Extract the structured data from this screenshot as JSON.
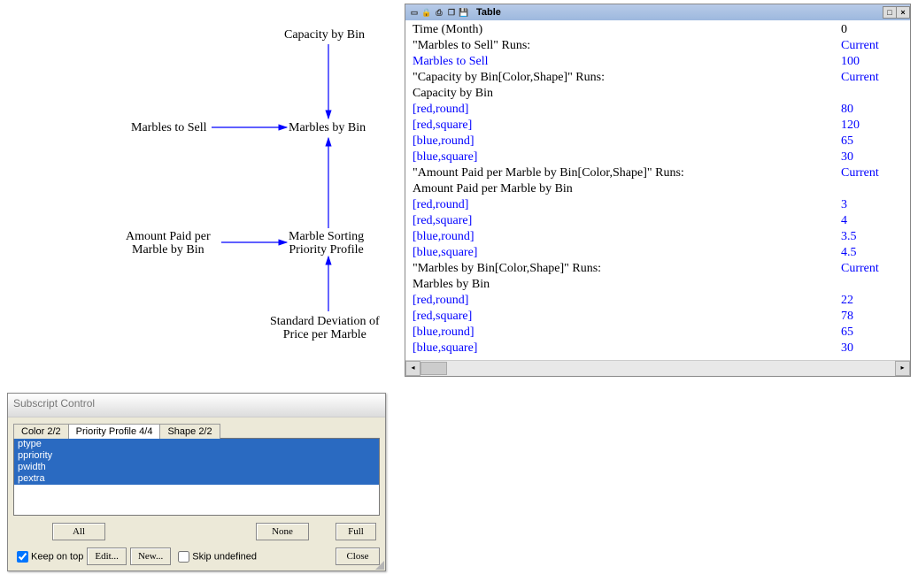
{
  "diagram": {
    "capacity_by_bin": "Capacity by Bin",
    "marbles_to_sell": "Marbles to Sell",
    "marbles_by_bin": "Marbles by Bin",
    "amount_paid_line1": "Amount Paid per",
    "amount_paid_line2": "Marble by Bin",
    "sorting_line1": "Marble Sorting",
    "sorting_line2": "Priority Profile",
    "stddev_line1": "Standard Deviation of",
    "stddev_line2": "Price per Marble"
  },
  "table_panel": {
    "title": "Table",
    "rows": [
      {
        "label": "Time (Month)",
        "value": "0",
        "lblue": false,
        "vblue": false
      },
      {
        "label": "\"Marbles to Sell\"  Runs:",
        "value": "Current",
        "lblue": false,
        "vblue": true
      },
      {
        "label": "Marbles to Sell",
        "value": "100",
        "lblue": true,
        "vblue": true
      },
      {
        "label": "\"Capacity by Bin[Color,Shape]\"  Runs:",
        "value": "Current",
        "lblue": false,
        "vblue": true
      },
      {
        "label": "Capacity by Bin",
        "value": "",
        "lblue": false,
        "vblue": false
      },
      {
        "label": "[red,round]",
        "value": "80",
        "lblue": true,
        "vblue": true
      },
      {
        "label": "[red,square]",
        "value": "120",
        "lblue": true,
        "vblue": true
      },
      {
        "label": "[blue,round]",
        "value": "65",
        "lblue": true,
        "vblue": true
      },
      {
        "label": "[blue,square]",
        "value": "30",
        "lblue": true,
        "vblue": true
      },
      {
        "label": "\"Amount Paid per Marble by Bin[Color,Shape]\"  Runs:",
        "value": "Current",
        "lblue": false,
        "vblue": true
      },
      {
        "label": "Amount Paid per Marble by Bin",
        "value": "",
        "lblue": false,
        "vblue": false
      },
      {
        "label": "[red,round]",
        "value": "3",
        "lblue": true,
        "vblue": true
      },
      {
        "label": "[red,square]",
        "value": "4",
        "lblue": true,
        "vblue": true
      },
      {
        "label": "[blue,round]",
        "value": "3.5",
        "lblue": true,
        "vblue": true
      },
      {
        "label": "[blue,square]",
        "value": "4.5",
        "lblue": true,
        "vblue": true
      },
      {
        "label": "\"Marbles by Bin[Color,Shape]\"  Runs:",
        "value": "Current",
        "lblue": false,
        "vblue": true
      },
      {
        "label": "Marbles by Bin",
        "value": "",
        "lblue": false,
        "vblue": false
      },
      {
        "label": "[red,round]",
        "value": "22",
        "lblue": true,
        "vblue": true
      },
      {
        "label": "[red,square]",
        "value": "78",
        "lblue": true,
        "vblue": true
      },
      {
        "label": "[blue,round]",
        "value": "65",
        "lblue": true,
        "vblue": true
      },
      {
        "label": "[blue,square]",
        "value": "30",
        "lblue": true,
        "vblue": true
      }
    ]
  },
  "subscript_control": {
    "title": "Subscript Control",
    "tabs": [
      {
        "label": "Color 2/2",
        "active": false
      },
      {
        "label": "Priority Profile 4/4",
        "active": true
      },
      {
        "label": "Shape 2/2",
        "active": false
      }
    ],
    "items": [
      "ptype",
      "ppriority",
      "pwidth",
      "pextra"
    ],
    "btn_all": "All",
    "btn_none": "None",
    "btn_full": "Full",
    "keep_on_top": "Keep on top",
    "keep_on_top_checked": true,
    "btn_edit": "Edit...",
    "btn_new": "New...",
    "skip_undefined": "Skip undefined",
    "skip_undefined_checked": false,
    "btn_close": "Close"
  }
}
